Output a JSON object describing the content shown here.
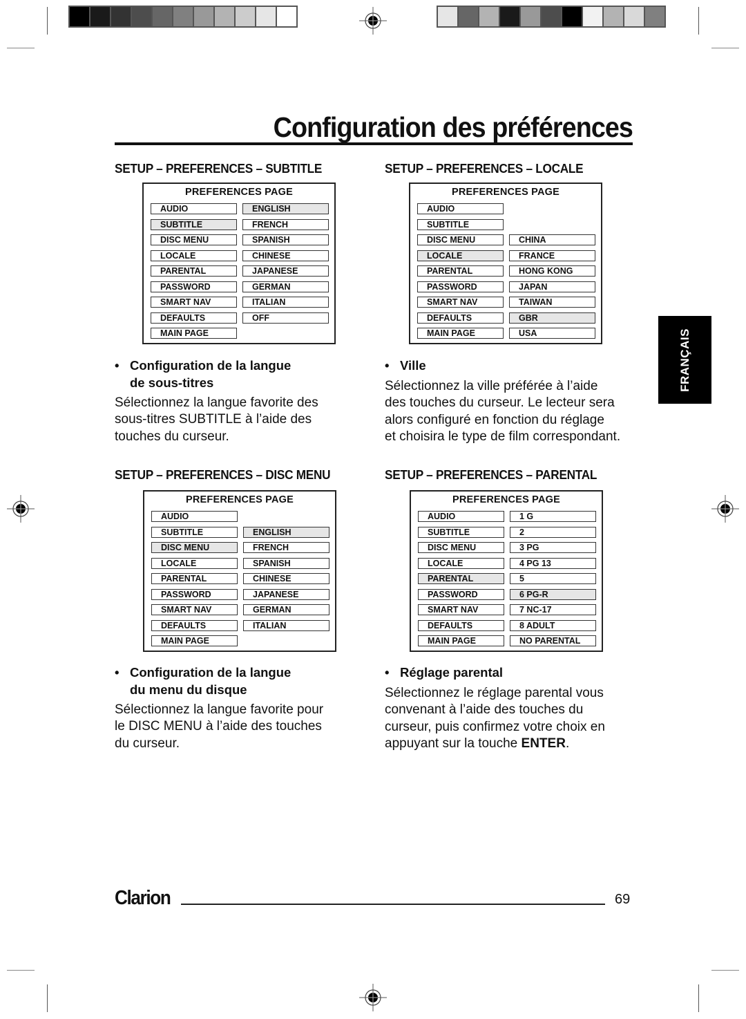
{
  "print_marks": {
    "colorbar_left": [
      "#000000",
      "#1a1a1a",
      "#333333",
      "#4d4d4d",
      "#666666",
      "#808080",
      "#999999",
      "#b3b3b3",
      "#cccccc",
      "#e6e6e6",
      "#ffffff"
    ],
    "colorbar_right": [
      "#e6e6e6",
      "#666666",
      "#b3b3b3",
      "#1a1a1a",
      "#999999",
      "#4d4d4d",
      "#000000",
      "#f2f2f2",
      "#b3b3b3",
      "#d9d9d9",
      "#808080"
    ]
  },
  "page": {
    "title": "Configuration des préférences",
    "language_tab": "FRANÇAIS",
    "brand": "Clarion",
    "page_number": "69"
  },
  "sections": [
    {
      "heading": "SETUP – PREFERENCES – SUBTITLE",
      "menu": {
        "title": "PREFERENCES  PAGE",
        "left": [
          "AUDIO",
          "SUBTITLE",
          "DISC MENU",
          "LOCALE",
          "PARENTAL",
          "PASSWORD",
          "SMART NAV",
          "DEFAULTS",
          "MAIN PAGE"
        ],
        "left_selected": "SUBTITLE",
        "right": [
          "ENGLISH",
          "FRENCH",
          "SPANISH",
          "CHINESE",
          "JAPANESE",
          "GERMAN",
          "ITALIAN",
          "OFF"
        ],
        "right_selected": "ENGLISH"
      },
      "bullet": "Configuration de la langue de sous-titres",
      "bullet_lines": [
        "Configuration de la langue",
        "de sous-titres"
      ],
      "body_lines": [
        "Sélectionnez la langue favorite des",
        "sous-titres SUBTITLE à l’aide des",
        "touches du curseur."
      ]
    },
    {
      "heading": "SETUP – PREFERENCES – LOCALE",
      "menu": {
        "title": "PREFERENCES  PAGE",
        "left": [
          "AUDIO",
          "SUBTITLE",
          "DISC MENU",
          "LOCALE",
          "PARENTAL",
          "PASSWORD",
          "SMART NAV",
          "DEFAULTS",
          "MAIN PAGE"
        ],
        "left_selected": "LOCALE",
        "right": [
          "CHINA",
          "FRANCE",
          "HONG KONG",
          "JAPAN",
          "TAIWAN",
          "GBR",
          "USA"
        ],
        "right_selected": "GBR"
      },
      "bullet": "Ville",
      "bullet_lines": [
        "Ville"
      ],
      "body_lines": [
        "Sélectionnez la ville préférée à l’aide",
        "des touches du curseur. Le lecteur sera",
        "alors configuré en fonction du réglage",
        "et choisira le type de film correspondant."
      ]
    },
    {
      "heading": "SETUP – PREFERENCES – DISC MENU",
      "menu": {
        "title": "PREFERENCES  PAGE",
        "left": [
          "AUDIO",
          "SUBTITLE",
          "DISC MENU",
          "LOCALE",
          "PARENTAL",
          "PASSWORD",
          "SMART NAV",
          "DEFAULTS",
          "MAIN PAGE"
        ],
        "left_selected": "DISC MENU",
        "right": [
          "ENGLISH",
          "FRENCH",
          "SPANISH",
          "CHINESE",
          "JAPANESE",
          "GERMAN",
          "ITALIAN"
        ],
        "right_selected": "ENGLISH"
      },
      "bullet": "Configuration de la langue du menu du disque",
      "bullet_lines": [
        "Configuration de la langue",
        "du menu du disque"
      ],
      "body_lines": [
        "Sélectionnez la langue favorite pour",
        "le DISC MENU à l’aide des touches",
        "du curseur."
      ]
    },
    {
      "heading": "SETUP – PREFERENCES – PARENTAL",
      "menu": {
        "title": "PREFERENCES  PAGE",
        "left": [
          "AUDIO",
          "SUBTITLE",
          "DISC MENU",
          "LOCALE",
          "PARENTAL",
          "PASSWORD",
          "SMART NAV",
          "DEFAULTS",
          "MAIN PAGE"
        ],
        "left_selected": "PARENTAL",
        "right": [
          "1 G",
          "2",
          "3 PG",
          "4 PG 13",
          "5",
          "6 PG-R",
          "7 NC-17",
          "8 ADULT",
          "NO PARENTAL"
        ],
        "right_selected": "6 PG-R"
      },
      "bullet": "Réglage parental",
      "bullet_lines": [
        "Réglage parental"
      ],
      "body_lines": [
        "Sélectionnez le réglage parental vous",
        "convenant à l’aide des touches du",
        "curseur, puis confirmez votre choix en",
        "appuyant sur la touche "
      ],
      "body_emphasis": "ENTER",
      "body_tail": "."
    }
  ]
}
